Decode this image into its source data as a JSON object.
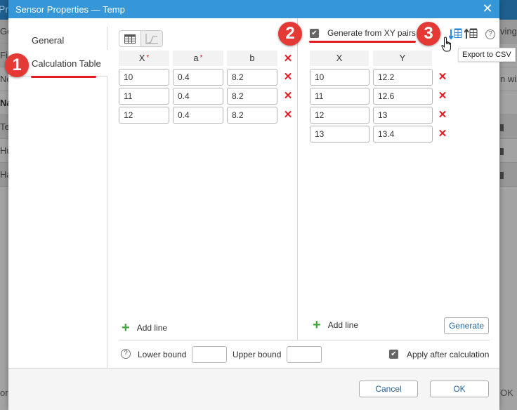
{
  "background": {
    "topbar_text": "Pro",
    "left_items": [
      "Gen",
      "File",
      "New",
      "Na",
      "Ter",
      "Hu",
      "Ha"
    ],
    "right_items": [
      "ving",
      "",
      "n wiz",
      "",
      "",
      "",
      ""
    ],
    "bottom_left": "ore",
    "bottom_right": "OK"
  },
  "dialog": {
    "title": "Sensor Properties — Temp",
    "close_icon": "close-icon",
    "tabs": [
      {
        "label": "General",
        "active": false
      },
      {
        "label": "Calculation Table",
        "active": true
      }
    ],
    "view_toggle": [
      {
        "icon": "table-icon",
        "active": true
      },
      {
        "icon": "chart-icon",
        "active": false
      }
    ],
    "calc_table": {
      "columns": [
        {
          "label": "X",
          "required": "*"
        },
        {
          "label": "a",
          "required": "*"
        },
        {
          "label": "b",
          "required": ""
        }
      ],
      "rows": [
        [
          "10",
          "0.4",
          "8.2"
        ],
        [
          "11",
          "0.4",
          "8.2"
        ],
        [
          "12",
          "0.4",
          "8.2"
        ]
      ],
      "add_line_label": "Add line"
    },
    "xy_pairs": {
      "generate_checkbox_label": "Generate from XY pairs",
      "generate_checked": true,
      "export_icon": "export-csv-icon",
      "import_icon": "import-csv-icon",
      "help_icon": "help-icon",
      "tooltip": "Export to CSV",
      "columns": [
        "X",
        "Y"
      ],
      "rows": [
        [
          "10",
          "12.2"
        ],
        [
          "11",
          "12.6"
        ],
        [
          "12",
          "13"
        ],
        [
          "13",
          "13.4"
        ]
      ],
      "add_line_label": "Add line",
      "generate_button": "Generate"
    },
    "bounds": {
      "help_symbol": "?",
      "lower_label": "Lower bound",
      "lower_value": "",
      "upper_label": "Upper bound",
      "upper_value": "",
      "apply_label": "Apply after calculation",
      "apply_checked": true
    },
    "footer": {
      "cancel": "Cancel",
      "ok": "OK"
    }
  },
  "annotations": {
    "badge_1": "1",
    "badge_2": "2",
    "badge_3": "3",
    "accent_color": "#e53935"
  }
}
